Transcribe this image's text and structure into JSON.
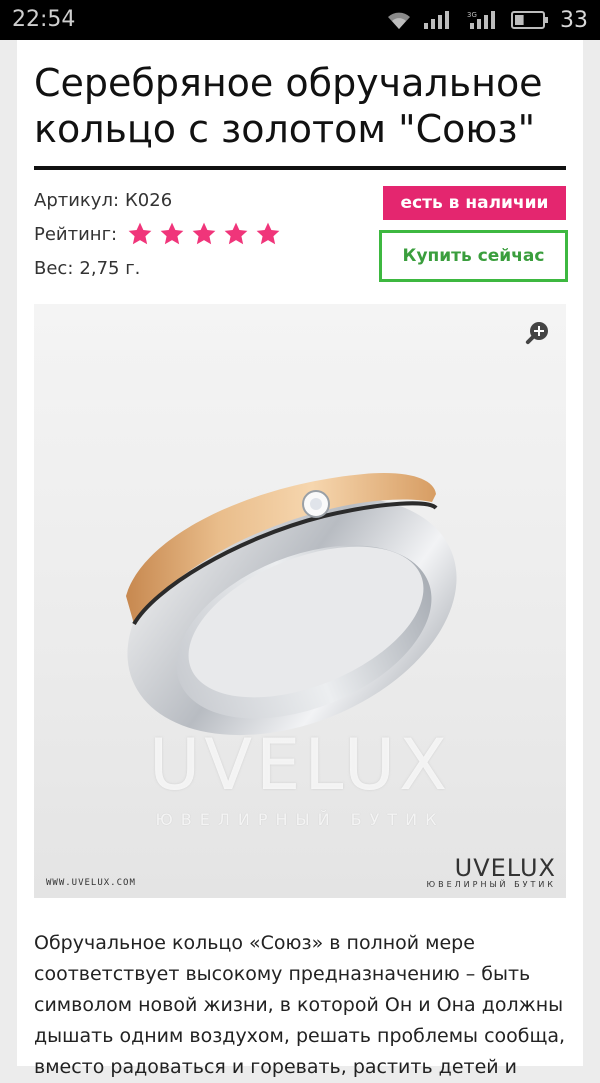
{
  "status_bar": {
    "time": "22:54",
    "battery_level": "33",
    "icons": [
      "wifi-icon",
      "signal-icon",
      "signal-3g-icon",
      "battery-icon"
    ]
  },
  "product": {
    "title": "Серебряное обручальное кольцо с золотом \"Союз\"",
    "sku_label": "Артикул:",
    "sku_value": "К026",
    "rating_label": "Рейтинг:",
    "rating_value": 5,
    "rating_max": 5,
    "weight_label": "Вес:",
    "weight_value": "2,75 г.",
    "stock_badge": "есть в наличии",
    "buy_button": "Купить сейчас",
    "description": "Обручальное кольцо «Союз» в полной мере соответствует высокому предназначению – быть символом новой жизни, в которой Он и Она должны дышать одним воздухом, решать проблемы сообща, вместо радоваться и горевать, растить детей и"
  },
  "image": {
    "watermark_brand": "UVELUX",
    "watermark_sub": "ЮВЕЛИРНЫЙ БУТИК",
    "site_url": "WWW.UVELUX.COM",
    "logo_name": "UVELUX",
    "logo_sub": "ЮВЕЛИРНЫЙ БУТИК",
    "zoom_icon": "zoom-in-icon"
  },
  "colors": {
    "accent_pink": "#e4266f",
    "buy_green": "#3db840",
    "star_pink": "#f0357a",
    "gold": "#d9a36b"
  }
}
